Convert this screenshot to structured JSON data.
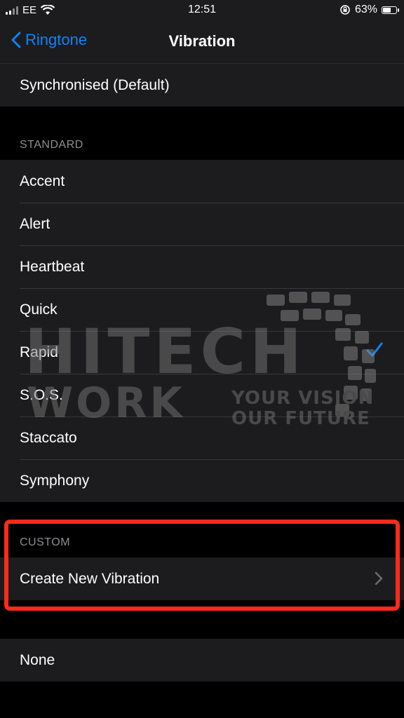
{
  "status_bar": {
    "carrier": "EE",
    "time": "12:51",
    "battery_percent": "63%",
    "battery_level": 0.63
  },
  "nav": {
    "back_label": "Ringtone",
    "title": "Vibration"
  },
  "top_group": {
    "items": [
      "Synchronised (Default)"
    ]
  },
  "standard": {
    "header": "STANDARD",
    "items": [
      "Accent",
      "Alert",
      "Heartbeat",
      "Quick",
      "Rapid",
      "S.O.S.",
      "Staccato",
      "Symphony"
    ],
    "selected": "Rapid"
  },
  "custom": {
    "header": "CUSTOM",
    "create_label": "Create New Vibration"
  },
  "bottom_group": {
    "none_label": "None"
  },
  "watermark": {
    "brand_top": "HITECH",
    "brand_bottom": "WORK",
    "tagline_1": "YOUR VISION",
    "tagline_2": "OUR FUTURE"
  },
  "colors": {
    "accent": "#0a84ff",
    "highlight": "#ff2a1a",
    "background": "#000000",
    "cell": "#1c1c1e"
  }
}
